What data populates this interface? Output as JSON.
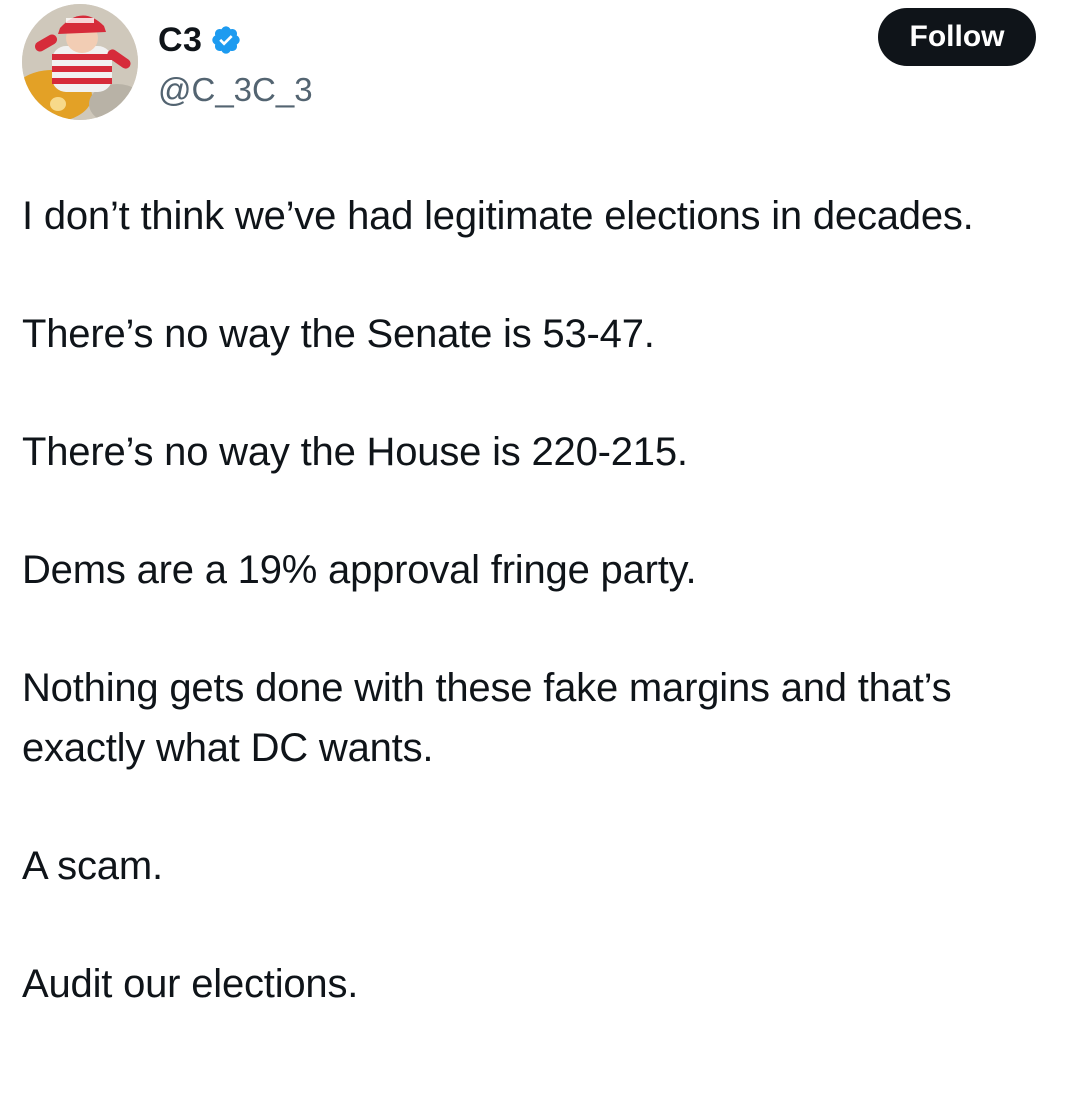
{
  "user": {
    "display_name": "C3",
    "handle": "@C_3C_3",
    "verified_icon": "verified-badge-icon",
    "avatar": "profile-photo"
  },
  "actions": {
    "follow_label": "Follow"
  },
  "tweet": {
    "paragraphs": [
      "I don’t think we’ve had legitimate elections in decades.",
      "There’s no way the Senate is 53-47.",
      "There’s no way the House is 220-215.",
      "Dems are a 19% approval fringe party.",
      "Nothing gets done with these fake margins and that’s exactly what DC wants.",
      "A scam.",
      "Audit our elections."
    ]
  },
  "colors": {
    "text": "#0f1419",
    "secondary_text": "#536471",
    "verified_blue": "#1d9bf0",
    "button_bg": "#0f1419",
    "button_text": "#ffffff"
  }
}
